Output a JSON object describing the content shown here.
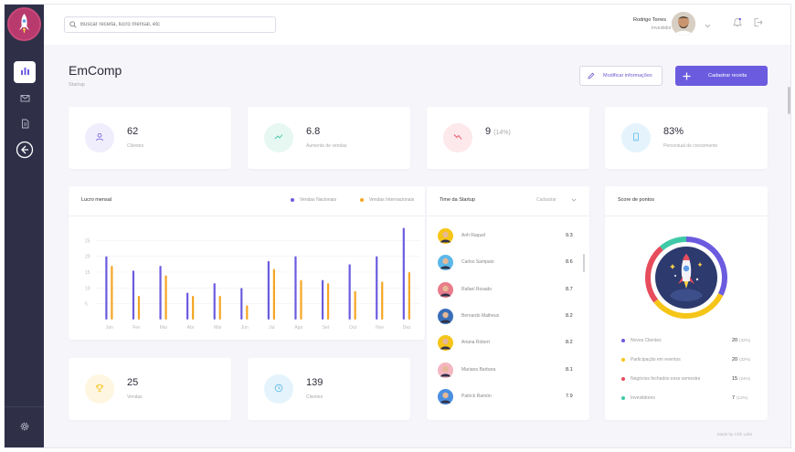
{
  "search": {
    "placeholder": "Buscar receita, lucro mensal, etc"
  },
  "user": {
    "name": "Rodrigo Torres",
    "role": "Investidor"
  },
  "page": {
    "title": "EmComp",
    "subtitle": "Startup"
  },
  "actions": {
    "edit_label": "Modificar informações",
    "add_label": "Cadastrar receita"
  },
  "stats": [
    {
      "value": "62",
      "label": "Clientes",
      "pct": ""
    },
    {
      "value": "6.8",
      "label": "Aumento de vendas",
      "pct": ""
    },
    {
      "value": "9",
      "label": "",
      "pct": "(14%)"
    },
    {
      "value": "83%",
      "label": "Percentual de crescimento",
      "pct": ""
    },
    {
      "value": "25",
      "label": "Vendas",
      "pct": ""
    },
    {
      "value": "139",
      "label": "Clientes",
      "pct": ""
    }
  ],
  "colors": {
    "accent": "#6b5bdf",
    "purple": "#6b5bdf",
    "orange": "#f5a623",
    "green": "#2ecc71",
    "red": "#e74c5c",
    "yellow": "#f5c518",
    "teal": "#3ec9a7"
  },
  "lucro": {
    "title": "Lucro mensal",
    "legend": [
      "Vendas Nacionais",
      "Vendas Internacionais"
    ]
  },
  "chart_data": {
    "type": "bar",
    "categories": [
      "Jan",
      "Fev",
      "Mar",
      "Abr",
      "Mai",
      "Jun",
      "Jul",
      "Ago",
      "Set",
      "Out",
      "Nov",
      "Dez"
    ],
    "series": [
      {
        "name": "Vendas Nacionais",
        "values": [
          20,
          15.5,
          17,
          8.5,
          11.5,
          10,
          18.5,
          20,
          12.5,
          17.5,
          20,
          29
        ]
      },
      {
        "name": "Vendas Internacionais",
        "values": [
          17,
          7.5,
          14,
          7.5,
          7.5,
          4.5,
          16,
          12.5,
          11.5,
          9,
          12,
          15
        ]
      }
    ],
    "yticks": [
      "5",
      "10",
      "15",
      "20",
      "25"
    ],
    "ylim": [
      0,
      30
    ],
    "grid": true
  },
  "team": {
    "title": "Time da Startup",
    "filter": "Cadastrar",
    "members": [
      {
        "name": "Anh Raquel",
        "score": "9.3",
        "color": "#f5c518"
      },
      {
        "name": "Carlos Sampaio",
        "score": "8.6",
        "color": "#5bb8e8"
      },
      {
        "name": "Rafael Rosado",
        "score": "8.7",
        "color": "#e87c8b"
      },
      {
        "name": "Bernardo Matheus",
        "score": "8.2",
        "color": "#3a6fb8"
      },
      {
        "name": "Ariana Robert",
        "score": "8.2",
        "color": "#f5c518"
      },
      {
        "name": "Mariana Barbara",
        "score": "8.1",
        "color": "#f4b6c0"
      },
      {
        "name": "Patrick Ramón",
        "score": "7.9",
        "color": "#4a8fe0"
      }
    ]
  },
  "score": {
    "title": "Score de pontos",
    "items": [
      {
        "label": "Novos Clientes",
        "value": "20",
        "pct": "(32%)",
        "color": "#6b5bdf"
      },
      {
        "label": "Participação em eventos",
        "value": "20",
        "pct": "(32%)",
        "color": "#f5c518"
      },
      {
        "label": "Negócios fechados esse semestre",
        "value": "15",
        "pct": "(24%)",
        "color": "#e74c5c"
      },
      {
        "label": "Investidores",
        "value": "7",
        "pct": "(12%)",
        "color": "#3ec9a7"
      }
    ]
  },
  "footer": "Made by Chili Labs"
}
